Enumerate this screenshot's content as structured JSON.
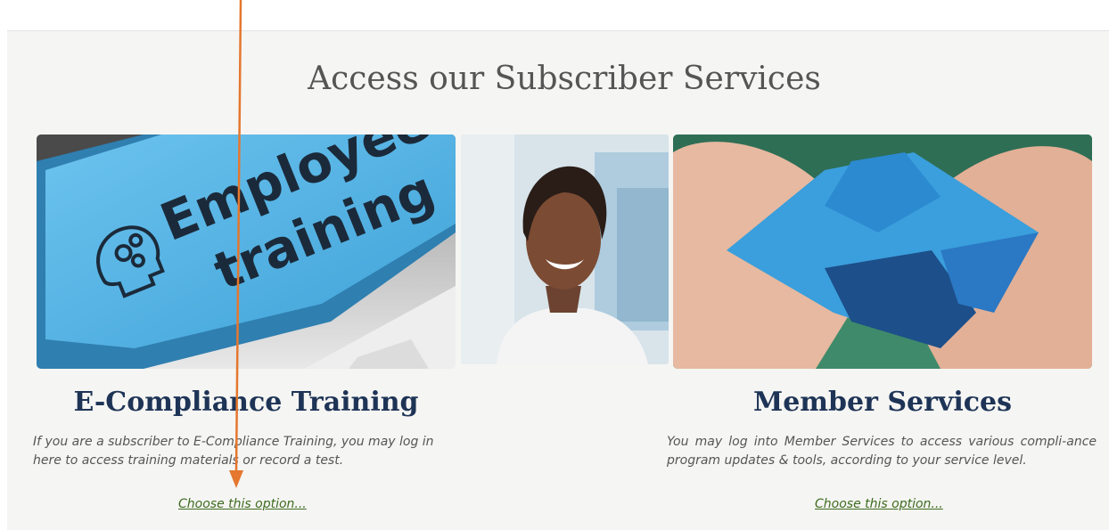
{
  "section": {
    "heading": "Access our Subscriber Services"
  },
  "training_card": {
    "image_alt": "Employee training keyboard key",
    "key_text_line1": "Employee",
    "key_text_line2": "training",
    "title": "E-Compliance Training",
    "description": "If you are a subscriber to E-Compliance Training, you may log in here to access training materials or record a test.",
    "link_label": "Choose this option..."
  },
  "person_image": {
    "image_alt": "Smiling professional woman"
  },
  "member_card": {
    "image_alt": "Hands holding blue puzzle pieces",
    "title": "Member Services",
    "description": "You may log into Member Services to access various compli-ance program updates & tools, according to your service level.",
    "link_label": "Choose this option..."
  },
  "colors": {
    "title": "#1e3456",
    "link": "#3e6b1f",
    "arrow": "#e5772e",
    "key_blue": "#5cb7e6"
  }
}
